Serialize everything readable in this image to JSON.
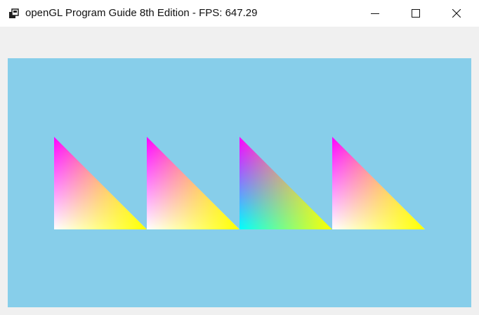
{
  "window": {
    "title": "openGL Program Guide 8th Edition - FPS: 647.29",
    "app_icon": "opengl-app-icon",
    "buttons": [
      {
        "name": "minimize",
        "icon": "minimize-icon"
      },
      {
        "name": "maximize",
        "icon": "maximize-icon"
      },
      {
        "name": "close",
        "icon": "close-icon"
      }
    ]
  },
  "viewport": {
    "clear_color": "#87ceea",
    "triangles": [
      {
        "name": "triangle-1",
        "top_color": "#ff00ff",
        "bottom_left_color": "#ffffff",
        "bottom_right_color": "#ffff00"
      },
      {
        "name": "triangle-2",
        "top_color": "#ff00ff",
        "bottom_left_color": "#ffffff",
        "bottom_right_color": "#ffff00"
      },
      {
        "name": "triangle-3",
        "top_color": "#ff00ff",
        "bottom_left_color": "#00ffff",
        "bottom_right_color": "#ffff00"
      },
      {
        "name": "triangle-4",
        "top_color": "#ff00ff",
        "bottom_left_color": "#ffffff",
        "bottom_right_color": "#ffff00"
      }
    ]
  }
}
